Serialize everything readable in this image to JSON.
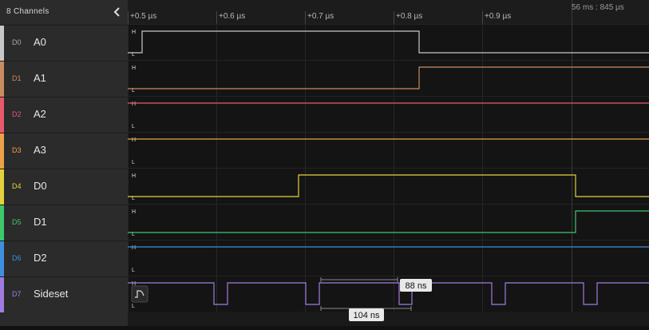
{
  "panel": {
    "title": "8 Channels",
    "collapse_icon": "chevron-left-icon"
  },
  "channels": [
    {
      "code": "D0",
      "name": "A0",
      "color": "#c8c8c8",
      "code_color": "#aaaaaa"
    },
    {
      "code": "D1",
      "name": "A1",
      "color": "#c98c5e",
      "code_color": "#d08a55"
    },
    {
      "code": "D2",
      "name": "A2",
      "color": "#e8596b",
      "code_color": "#e8596b"
    },
    {
      "code": "D3",
      "name": "A3",
      "color": "#eda24a",
      "code_color": "#eda24a"
    },
    {
      "code": "D4",
      "name": "D0",
      "color": "#e3d23d",
      "code_color": "#e3d23d"
    },
    {
      "code": "D5",
      "name": "D1",
      "color": "#3fc76b",
      "code_color": "#3fc76b"
    },
    {
      "code": "D6",
      "name": "D2",
      "color": "#3f8fe0",
      "code_color": "#3f8fe0"
    },
    {
      "code": "D7",
      "name": "Sideset",
      "color": "#a07ce0",
      "code_color": "#a07ce0"
    }
  ],
  "timeline": {
    "ticks": [
      "+0.5 µs",
      "+0.6 µs",
      "+0.7 µs",
      "+0.8 µs",
      "+0.9 µs"
    ],
    "cursor_label": "56 ms : 845 µs"
  },
  "levels": {
    "high": "H",
    "low": "L"
  },
  "measurements": {
    "width": "88 ns",
    "period": "104 ns"
  },
  "marker_icon": "pulse-trigger-icon",
  "colors": {
    "panel_bg": "#2b2b2b",
    "plot_bg": "#111111",
    "grid": "#2a2a2a"
  }
}
